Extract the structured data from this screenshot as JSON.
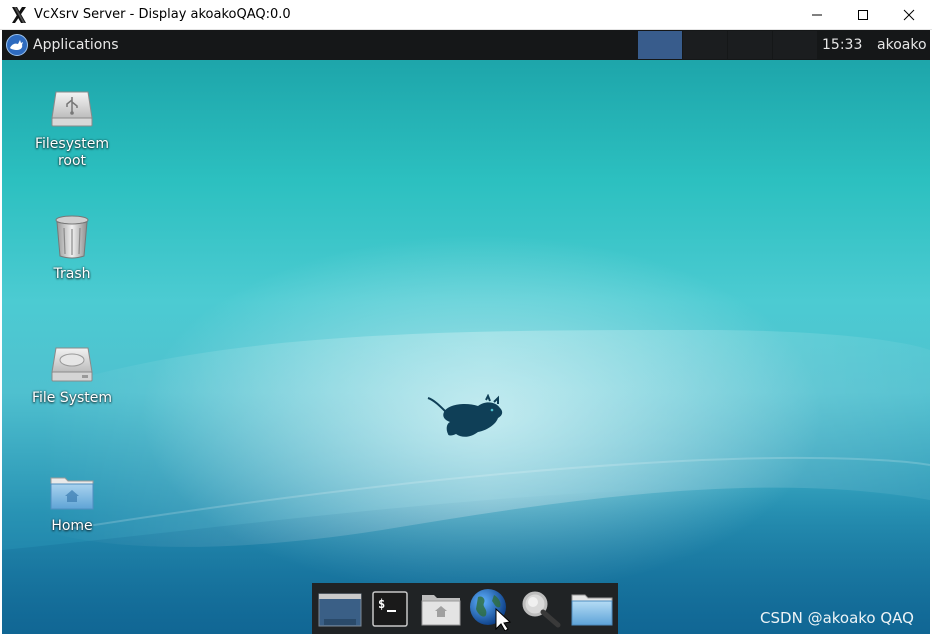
{
  "window": {
    "title": "VcXsrv Server - Display akoakoQAQ:0.0",
    "minimize_icon": "minimize-icon",
    "maximize_icon": "maximize-icon",
    "close_icon": "close-icon"
  },
  "panel": {
    "applications_label": "Applications",
    "clock": "15:33",
    "user": "akoako",
    "active_workspace_color": "#385c8c"
  },
  "desktop": {
    "icons": [
      {
        "label": "Filesystem\nroot",
        "icon": "usb-drive-icon"
      },
      {
        "label": "Trash",
        "icon": "trash-icon"
      },
      {
        "label": "File System",
        "icon": "hard-drive-icon"
      },
      {
        "label": "Home",
        "icon": "home-folder-icon"
      }
    ],
    "wallpaper_mascot": "xfce-mouse-icon"
  },
  "dock": {
    "items": [
      "show-desktop-icon",
      "terminal-icon",
      "file-manager-icon",
      "web-browser-icon",
      "search-icon",
      "folder-icon"
    ]
  },
  "watermark": "CSDN @akoako QAQ"
}
